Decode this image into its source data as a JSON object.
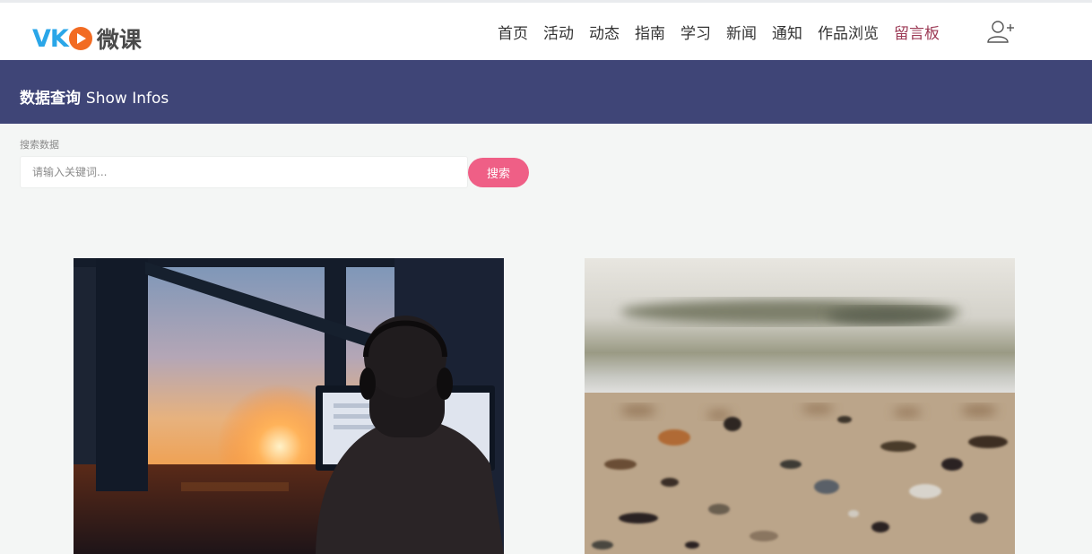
{
  "logo": {
    "brand_latin": "VK",
    "brand_latin_v": "V",
    "brand_latin_k": "K",
    "brand_cn": "微课",
    "colors": {
      "blue": "#2aa6e8",
      "orange": "#f26b22",
      "text": "#4a4a4a"
    }
  },
  "nav": {
    "items": [
      {
        "label": "首页"
      },
      {
        "label": "活动"
      },
      {
        "label": "动态"
      },
      {
        "label": "指南"
      },
      {
        "label": "学习"
      },
      {
        "label": "新闻"
      },
      {
        "label": "通知"
      },
      {
        "label": "作品浏览"
      },
      {
        "label": "留言板",
        "active": true
      }
    ],
    "active_color": "#9c3a55",
    "user_icon": "user-add-icon"
  },
  "banner": {
    "title_cn": "数据查询",
    "title_en": "Show Infos",
    "background": "#3f4577"
  },
  "search": {
    "label": "搜索数据",
    "placeholder": "请输入关键词...",
    "value": "",
    "button_label": "搜索",
    "button_color": "#ef5f86"
  },
  "cards": [
    {
      "image": "person-with-headphones-at-computer-sunset-photo"
    },
    {
      "image": "blurred-pebble-beach-photo"
    }
  ]
}
